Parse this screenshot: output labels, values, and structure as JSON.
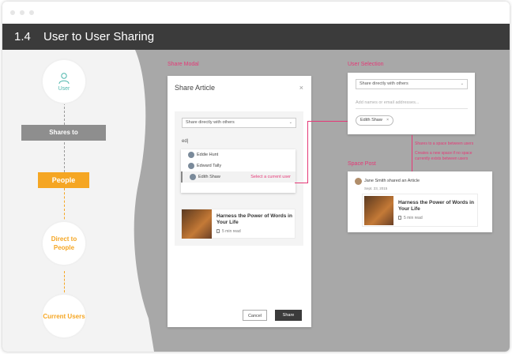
{
  "header": {
    "section_number": "1.4",
    "title": "User to User Sharing"
  },
  "flow": {
    "user_label": "User",
    "shares_to_label": "Shares to",
    "people_label": "People",
    "direct_to_people_label": "Direct to People",
    "current_users_label": "Current Users"
  },
  "labels": {
    "share_modal": "Share Modal",
    "user_selection": "User Selection",
    "space_post": "Space Post"
  },
  "share_modal": {
    "title": "Share Article",
    "close_glyph": "×",
    "select_value": "Share directly with others",
    "typed_value": "ed|",
    "dropdown_items": [
      {
        "name": "Eddie Hunt"
      },
      {
        "name": "Edward Tally"
      },
      {
        "name": "Edith Shaw"
      }
    ],
    "select_hint": "Select a current user",
    "article_title": "Harness the Power of Words in Your Life",
    "read_time": "5 min read",
    "cancel_label": "Cancel",
    "share_label": "Share"
  },
  "user_selection": {
    "select_value": "Share directly with others",
    "input_placeholder": "Add names or email addresses...",
    "chip_name": "Edith Shaw",
    "chip_close": "×"
  },
  "annotations": {
    "line1": "Shares to a space between users",
    "line2": "Creates a new space if no space currently exists between users"
  },
  "space_post": {
    "shared_text": "Jane Smith shared an Article",
    "date": "Sept. 23, 2015",
    "article_title": "Harness the Power of Words in Your Life",
    "read_time": "5 min read"
  },
  "colors": {
    "accent_orange": "#f5a623",
    "accent_pink": "#e53977",
    "accent_teal": "#4db6ac",
    "header_dark": "#3b3b3b"
  }
}
